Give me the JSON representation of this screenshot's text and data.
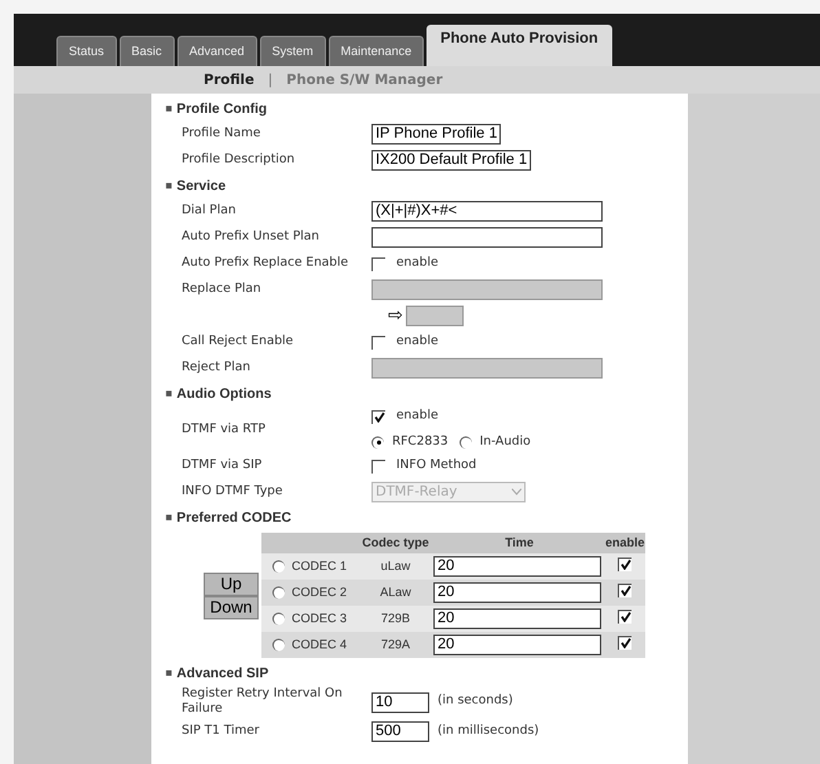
{
  "tabs": [
    {
      "label": "Status",
      "selected": false
    },
    {
      "label": "Basic",
      "selected": false
    },
    {
      "label": "Advanced",
      "selected": false
    },
    {
      "label": "System",
      "selected": false
    },
    {
      "label": "Maintenance",
      "selected": false
    },
    {
      "label": "Phone Auto Provision",
      "selected": true
    }
  ],
  "subnav": {
    "items": [
      {
        "label": "Profile",
        "selected": true
      },
      {
        "label": "Phone S/W Manager",
        "selected": false
      }
    ],
    "separator": "|"
  },
  "rows": [
    {
      "kind": "section",
      "marker": "▪",
      "label": "Profile Config"
    },
    {
      "kind": "short_text",
      "label": "Profile Name",
      "value": "IP Phone Profile 1",
      "disabled": false
    },
    {
      "kind": "short_text",
      "label": "Profile Description",
      "value": "IX200 Default Profile 1",
      "disabled": false
    },
    {
      "kind": "section",
      "marker": "▪",
      "label": "Service"
    },
    {
      "kind": "text",
      "label": "Dial Plan",
      "value": "(X|+|#)X+#<",
      "disabled": false
    },
    {
      "kind": "text",
      "label": "Auto Prefix Unset Plan",
      "disabled": false
    },
    {
      "kind": "checkbox",
      "label": "Auto Prefix Replace Enable",
      "option": "enable",
      "checked": false
    },
    {
      "kind": "text",
      "label": "Replace Plan",
      "disabled": true
    },
    {
      "kind": "arrow",
      "symbol": "⇨",
      "disabled": true
    },
    {
      "kind": "checkbox",
      "label": "Call Reject Enable",
      "option": "enable",
      "checked": false
    },
    {
      "kind": "text",
      "label": "Reject Plan",
      "disabled": true
    },
    {
      "kind": "section",
      "marker": "▪",
      "label": "Audio Options"
    },
    {
      "kind": "dtmf",
      "label": "DTMF via RTP",
      "option": "enable",
      "checked": true,
      "radios": [
        {
          "label": "RFC2833",
          "selected": true
        },
        {
          "label": "In-Audio",
          "selected": false
        }
      ]
    },
    {
      "kind": "checkbox",
      "label": "DTMF via SIP",
      "option": "INFO Method",
      "checked": false
    },
    {
      "kind": "select",
      "label": "INFO DTMF Type",
      "value": "DTMF-Relay",
      "disabled": true
    },
    {
      "kind": "section",
      "marker": "▪",
      "label": "Preferred CODEC"
    },
    {
      "kind": "codecs",
      "buttons": [
        "Up",
        "Down"
      ],
      "columns": [
        "Codec type",
        "Time",
        "enable"
      ],
      "codecs": [
        {
          "name": "CODEC 1",
          "type": "uLaw",
          "time": "20",
          "selected": false,
          "enabled": true
        },
        {
          "name": "CODEC 2",
          "type": "ALaw",
          "time": "20",
          "selected": false,
          "enabled": true
        },
        {
          "name": "CODEC 3",
          "type": "729B",
          "time": "20",
          "selected": false,
          "enabled": true
        },
        {
          "name": "CODEC 4",
          "type": "729A",
          "time": "20",
          "selected": false,
          "enabled": true
        }
      ]
    },
    {
      "kind": "section",
      "marker": "▪",
      "label": "Advanced SIP"
    },
    {
      "kind": "unit",
      "label": "Register Retry Interval On Failure",
      "value": "10",
      "unit": "(in seconds)"
    },
    {
      "kind": "unit",
      "label": "SIP T1 Timer",
      "value": "500",
      "unit": "(in milliseconds)"
    }
  ]
}
